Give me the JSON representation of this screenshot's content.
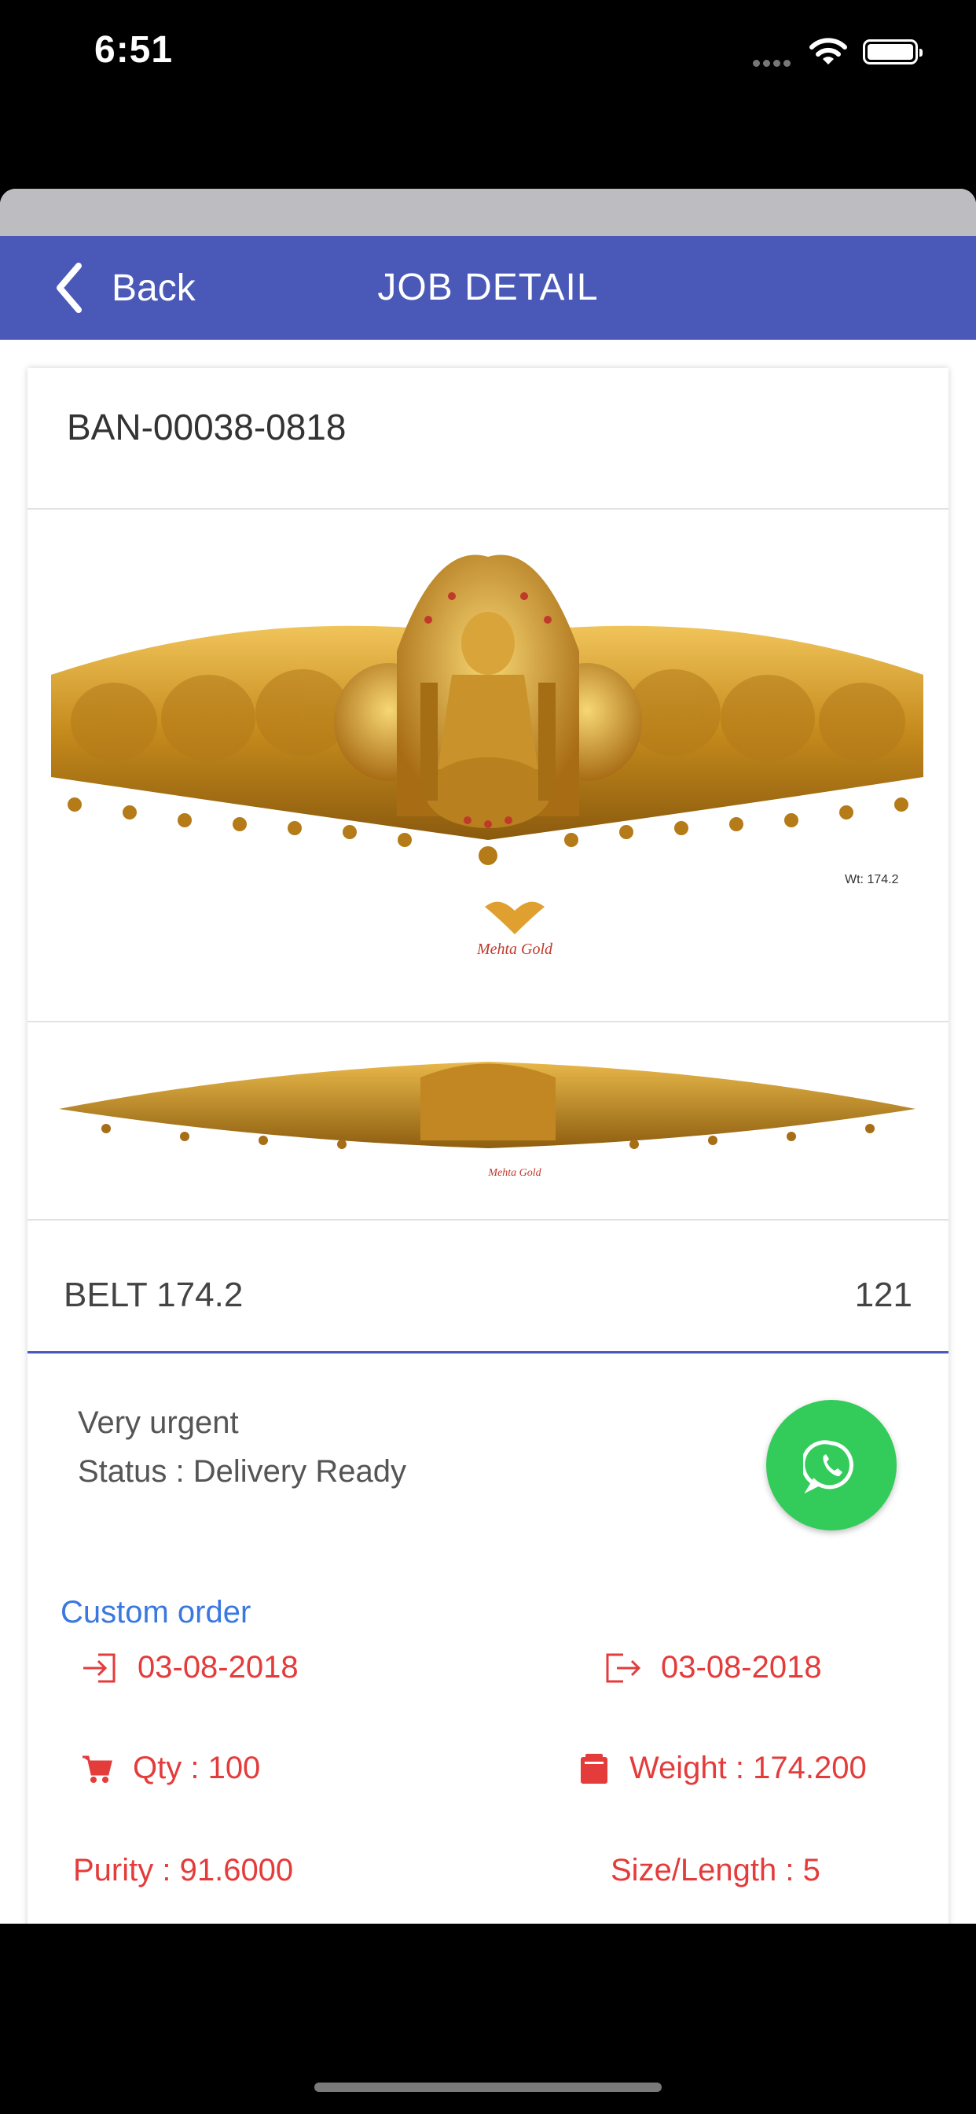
{
  "status_bar": {
    "time": "6:51"
  },
  "nav": {
    "back_label": "Back",
    "title": "JOB DETAIL"
  },
  "job": {
    "id": "BAN-00038-0818",
    "image_watermark_weight": "Wt: 174.2",
    "brand_watermark": "Mehta Gold",
    "item_name": "BELT 174.2",
    "item_count": "121",
    "note_line1": "Very urgent",
    "note_line2": "Status : Delivery Ready",
    "order_type": "Custom order",
    "date_in": "03-08-2018",
    "date_out": "03-08-2018",
    "qty": "Qty : 100",
    "weight": "Weight : 174.200",
    "purity": "Purity : 91.6000",
    "size": "Size/Length : 5"
  },
  "colors": {
    "nav": "#4a59b7",
    "accent_red": "#e43b3b",
    "link_blue": "#3a78e0",
    "whatsapp": "#33cc5a"
  }
}
